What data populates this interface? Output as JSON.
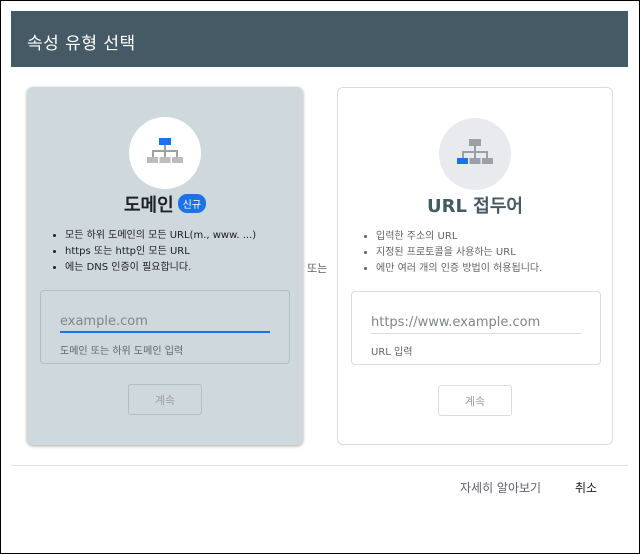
{
  "dialog": {
    "title": "속성 유형 선택"
  },
  "domain_card": {
    "icon": "sitemap-icon",
    "title": "도메인",
    "badge": "신규",
    "bullets": [
      "모든 하위 도메인의 모든 URL(m., www. ...)",
      "https 또는 http인 모든 URL",
      "에는 DNS 인증이 필요합니다."
    ],
    "input_placeholder": "example.com",
    "input_hint": "도메인 또는 하위 도메인 입력",
    "continue_label": "계속"
  },
  "or_label": "또는",
  "prefix_card": {
    "icon": "sitemap-icon",
    "title": "URL 접두어",
    "bullets": [
      "입력한 주소의 URL",
      "지정된 프로토콜을 사용하는 URL",
      "에만 여러 개의 인증 방법이 허용됩니다."
    ],
    "input_placeholder": "https://www.example.com",
    "input_hint": "URL 입력",
    "continue_label": "계속"
  },
  "footer": {
    "learn_more": "자세히 알아보기",
    "cancel": "취소"
  },
  "colors": {
    "header_bg": "#455a64",
    "accent": "#1a73e8",
    "domain_card_bg": "#cfd8dc"
  }
}
